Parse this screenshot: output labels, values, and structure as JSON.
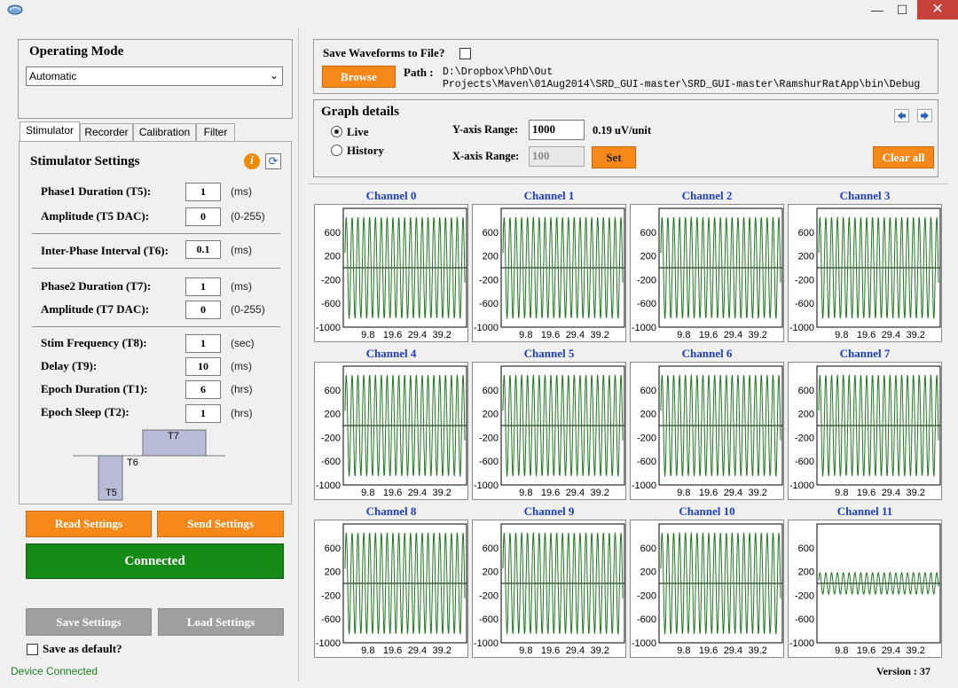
{
  "window": {
    "minimize": "—",
    "maximize": "☐",
    "close": "✕"
  },
  "operating_mode": {
    "title": "Operating Mode",
    "selected": "Automatic"
  },
  "tabs": [
    "Stimulator",
    "Recorder",
    "Calibration",
    "Filter"
  ],
  "stimulator": {
    "title": "Stimulator Settings",
    "fields": [
      {
        "label": "Phase1 Duration (T5):",
        "value": "1",
        "unit": "(ms)"
      },
      {
        "label": "Amplitude (T5 DAC):",
        "value": "0",
        "unit": "(0-255)"
      },
      {
        "label": "Inter-Phase Interval (T6):",
        "value": "0.1",
        "unit": "(ms)"
      },
      {
        "label": "Phase2 Duration (T7):",
        "value": "1",
        "unit": "(ms)"
      },
      {
        "label": "Amplitude (T7 DAC):",
        "value": "0",
        "unit": "(0-255)"
      },
      {
        "label": "Stim Frequency (T8):",
        "value": "1",
        "unit": "(sec)"
      },
      {
        "label": "Delay (T9):",
        "value": "10",
        "unit": "(ms)"
      },
      {
        "label": "Epoch Duration (T1):",
        "value": "6",
        "unit": "(hrs)"
      },
      {
        "label": "Epoch Sleep (T2):",
        "value": "1",
        "unit": "(hrs)"
      }
    ],
    "diagram": {
      "t5": "T5",
      "t6": "T6",
      "t7": "T7"
    }
  },
  "buttons": {
    "read": "Read Settings",
    "send": "Send Settings",
    "connected": "Connected",
    "save": "Save Settings",
    "load": "Load Settings",
    "save_default": "Save as default?"
  },
  "status": {
    "device": "Device Connected",
    "version": "Version : 37"
  },
  "save_panel": {
    "label": "Save Waveforms to File?",
    "browse": "Browse",
    "path_label": "Path :",
    "path_line1": "D:\\Dropbox\\PhD\\Out",
    "path_line2": "Projects\\Maven\\01Aug2014\\SRD_GUI-master\\SRD_GUI-master\\RamshurRatApp\\bin\\Debug"
  },
  "graph_details": {
    "title": "Graph details",
    "live": "Live",
    "history": "History",
    "selected_mode": "Live",
    "y_label": "Y-axis Range:",
    "y_value": "1000",
    "y_unit": "0.19 uV/unit",
    "x_label": "X-axis Range:",
    "x_value": "100",
    "set": "Set",
    "clear_all": "Clear all",
    "prev_icon": "arrow-left-icon",
    "next_icon": "arrow-right-icon"
  },
  "chart_data": {
    "type": "line",
    "y_ticks": [
      "600",
      "200",
      "-200",
      "-600",
      "-1000"
    ],
    "x_ticks": [
      "9.8",
      "19.6",
      "29.4",
      "39.2"
    ],
    "ylim": [
      -1000,
      1000
    ],
    "line_color": "#1a7a1a",
    "channels": [
      {
        "name": "Channel 0",
        "amplitude": 850
      },
      {
        "name": "Channel 1",
        "amplitude": 850
      },
      {
        "name": "Channel 2",
        "amplitude": 850
      },
      {
        "name": "Channel 3",
        "amplitude": 850
      },
      {
        "name": "Channel 4",
        "amplitude": 850
      },
      {
        "name": "Channel 5",
        "amplitude": 850
      },
      {
        "name": "Channel 6",
        "amplitude": 850
      },
      {
        "name": "Channel 7",
        "amplitude": 850
      },
      {
        "name": "Channel 8",
        "amplitude": 850
      },
      {
        "name": "Channel 9",
        "amplitude": 850
      },
      {
        "name": "Channel 10",
        "amplitude": 850
      },
      {
        "name": "Channel 11",
        "amplitude": 180
      }
    ]
  }
}
